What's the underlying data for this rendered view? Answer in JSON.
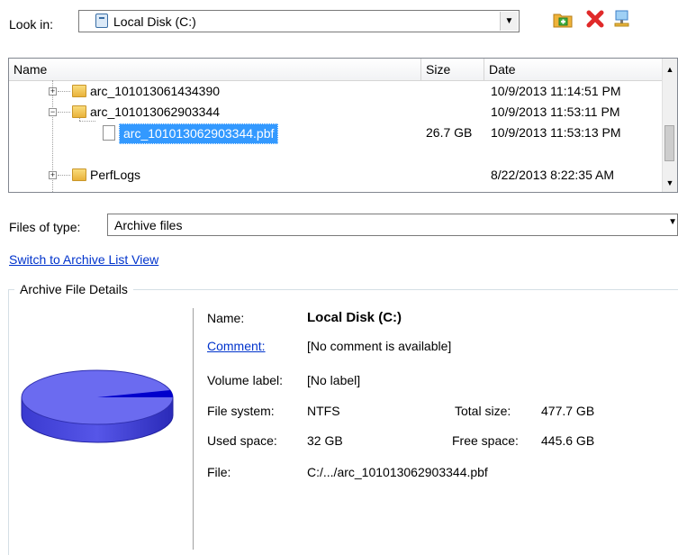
{
  "lookin": {
    "label": "Look in:",
    "value": "Local Disk (C:)",
    "drive_icon": "drive-icon",
    "toolbar": [
      {
        "name": "add-folder-icon",
        "color": "#e8a325"
      },
      {
        "name": "delete-icon",
        "color": "#e02a2a"
      },
      {
        "name": "network-icon",
        "color": "#3c7fc8"
      }
    ]
  },
  "list": {
    "columns": [
      "Name",
      "Size",
      "Date"
    ],
    "rows": [
      {
        "name": "arc_101013061434390",
        "size": "",
        "date": "10/9/2013 11:14:51 PM",
        "type": "folder",
        "expander": "+"
      },
      {
        "name": "arc_101013062903344",
        "size": "",
        "date": "10/9/2013 11:53:11 PM",
        "type": "folder",
        "expander": "−"
      },
      {
        "name": "arc_101013062903344.pbf",
        "size": "26.7 GB",
        "date": "10/9/2013 11:53:13 PM",
        "type": "file",
        "selected": true
      },
      {
        "name": "PerfLogs",
        "size": "",
        "date": "8/22/2013 8:22:35 AM",
        "type": "folder",
        "expander": "+"
      }
    ]
  },
  "files_of_type": {
    "label": "Files of type:",
    "value": "Archive files"
  },
  "switch_link": "Switch to Archive List View",
  "details": {
    "legend": "Archive File Details",
    "name_label": "Name:",
    "name_value": "Local Disk (C:)",
    "comment_label": "Comment:",
    "comment_value": "[No comment is available]",
    "volume_label": "Volume label:",
    "volume_value": "[No label]",
    "fs_label": "File system:",
    "fs_value": "NTFS",
    "total_label": "Total size:",
    "total_value": "477.7 GB",
    "used_label": "Used space:",
    "used_value": "32 GB",
    "free_label": "Free space:",
    "free_value": "445.6 GB",
    "file_label": "File:",
    "file_value": "C:/.../arc_101013062903344.pbf",
    "pie_colors": {
      "free": "#6b6bf0",
      "used": "#0000cc"
    }
  }
}
